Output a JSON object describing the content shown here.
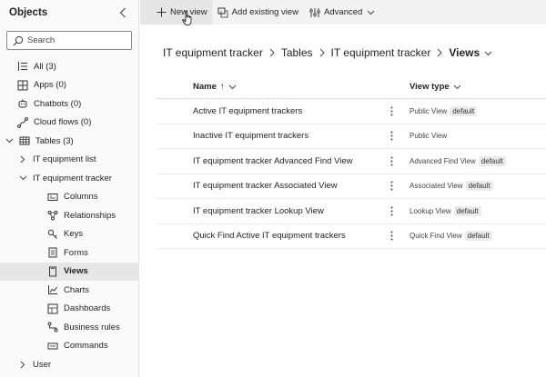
{
  "sidebar": {
    "title": "Objects",
    "search_placeholder": "Search",
    "items": [
      {
        "label": "All (3)",
        "icon": "list-icon"
      },
      {
        "label": "Apps (0)",
        "icon": "apps-icon"
      },
      {
        "label": "Chatbots (0)",
        "icon": "chatbot-icon"
      },
      {
        "label": "Cloud flows (0)",
        "icon": "flow-icon"
      },
      {
        "label": "Tables (3)",
        "icon": "table-icon"
      },
      {
        "label": "IT equipment list"
      },
      {
        "label": "IT equipment tracker"
      },
      {
        "label": "Columns",
        "icon": "columns-icon"
      },
      {
        "label": "Relationships",
        "icon": "relationships-icon"
      },
      {
        "label": "Keys",
        "icon": "key-icon"
      },
      {
        "label": "Forms",
        "icon": "form-icon"
      },
      {
        "label": "Views",
        "icon": "view-icon"
      },
      {
        "label": "Charts",
        "icon": "chart-icon"
      },
      {
        "label": "Dashboards",
        "icon": "dashboard-icon"
      },
      {
        "label": "Business rules",
        "icon": "business-rule-icon"
      },
      {
        "label": "Commands",
        "icon": "command-icon"
      },
      {
        "label": "User"
      }
    ]
  },
  "toolbar": {
    "new_view": "New view",
    "add_existing": "Add existing view",
    "advanced": "Advanced"
  },
  "breadcrumb": {
    "items": [
      "IT equipment tracker",
      "Tables",
      "IT equipment tracker"
    ],
    "current": "Views"
  },
  "grid": {
    "col_name": "Name",
    "col_name_sort": "↑",
    "col_type": "View type",
    "rows": [
      {
        "name": "Active IT equipment trackers",
        "type": "Public View",
        "badge": "default"
      },
      {
        "name": "Inactive IT equipment trackers",
        "type": "Public View",
        "badge": ""
      },
      {
        "name": "IT equipment tracker Advanced Find View",
        "type": "Advanced Find View",
        "badge": "default"
      },
      {
        "name": "IT equipment tracker Associated View",
        "type": "Associated View",
        "badge": "default"
      },
      {
        "name": "IT equipment tracker Lookup View",
        "type": "Lookup View",
        "badge": "default"
      },
      {
        "name": "Quick Find Active IT equipment trackers",
        "type": "Quick Find View",
        "badge": "default"
      }
    ]
  }
}
